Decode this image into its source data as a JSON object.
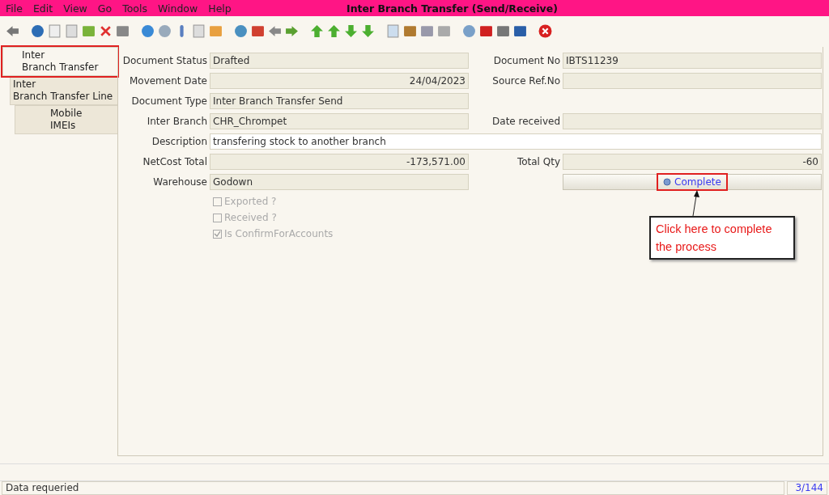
{
  "window": {
    "title": "Inter Branch Transfer (Send/Receive)"
  },
  "menu": [
    "File",
    "Edit",
    "View",
    "Go",
    "Tools",
    "Window",
    "Help"
  ],
  "tabs": [
    {
      "label": "Inter\nBranch Transfer",
      "selected": true,
      "highlighted": true
    },
    {
      "label": "Inter\nBranch Transfer Line",
      "selected": false,
      "highlighted": false,
      "children": [
        {
          "label": "Mobile\nIMEIs",
          "selected": false,
          "highlighted": false
        }
      ]
    }
  ],
  "rows": [
    {
      "left": {
        "label": "Document Status",
        "value": "Drafted",
        "kind": "text"
      },
      "right": {
        "label": "Document No",
        "value": "IBTS11239",
        "kind": "text"
      }
    },
    {
      "left": {
        "label": "Movement Date",
        "value": "24/04/2023",
        "kind": "number"
      },
      "right": {
        "label": "Source Ref.No",
        "kind": "text"
      }
    },
    {
      "left": {
        "label": "Document Type",
        "value": "Inter Branch Transfer Send",
        "kind": "text"
      }
    },
    {
      "left": {
        "label": "Inter Branch",
        "value": "CHR_Chrompet",
        "kind": "text"
      },
      "right": {
        "label": "Date received",
        "kind": "text"
      }
    },
    {
      "full": {
        "label": "Description",
        "value": "transfering stock to another branch",
        "kind": "editable"
      }
    },
    {
      "left": {
        "label": "NetCost Total",
        "value": "-173,571.00",
        "kind": "number"
      },
      "right": {
        "label": "Total Qty",
        "value": "-60",
        "kind": "number"
      }
    },
    {
      "left": {
        "label": "Warehouse",
        "value": "Godown",
        "kind": "text"
      },
      "right": {
        "kind": "button",
        "value": "Complete",
        "highlighted": true
      }
    }
  ],
  "checkboxes": [
    {
      "label": "Exported ?",
      "checked": false,
      "disabled": true
    },
    {
      "label": "Received ?",
      "checked": false,
      "disabled": true
    },
    {
      "label": "Is ConfirmForAccounts",
      "checked": true,
      "disabled": true
    }
  ],
  "annotation": {
    "text": "Click here to complete the process"
  },
  "status_bar": {
    "message": "Data requeried",
    "record": "3/144"
  }
}
